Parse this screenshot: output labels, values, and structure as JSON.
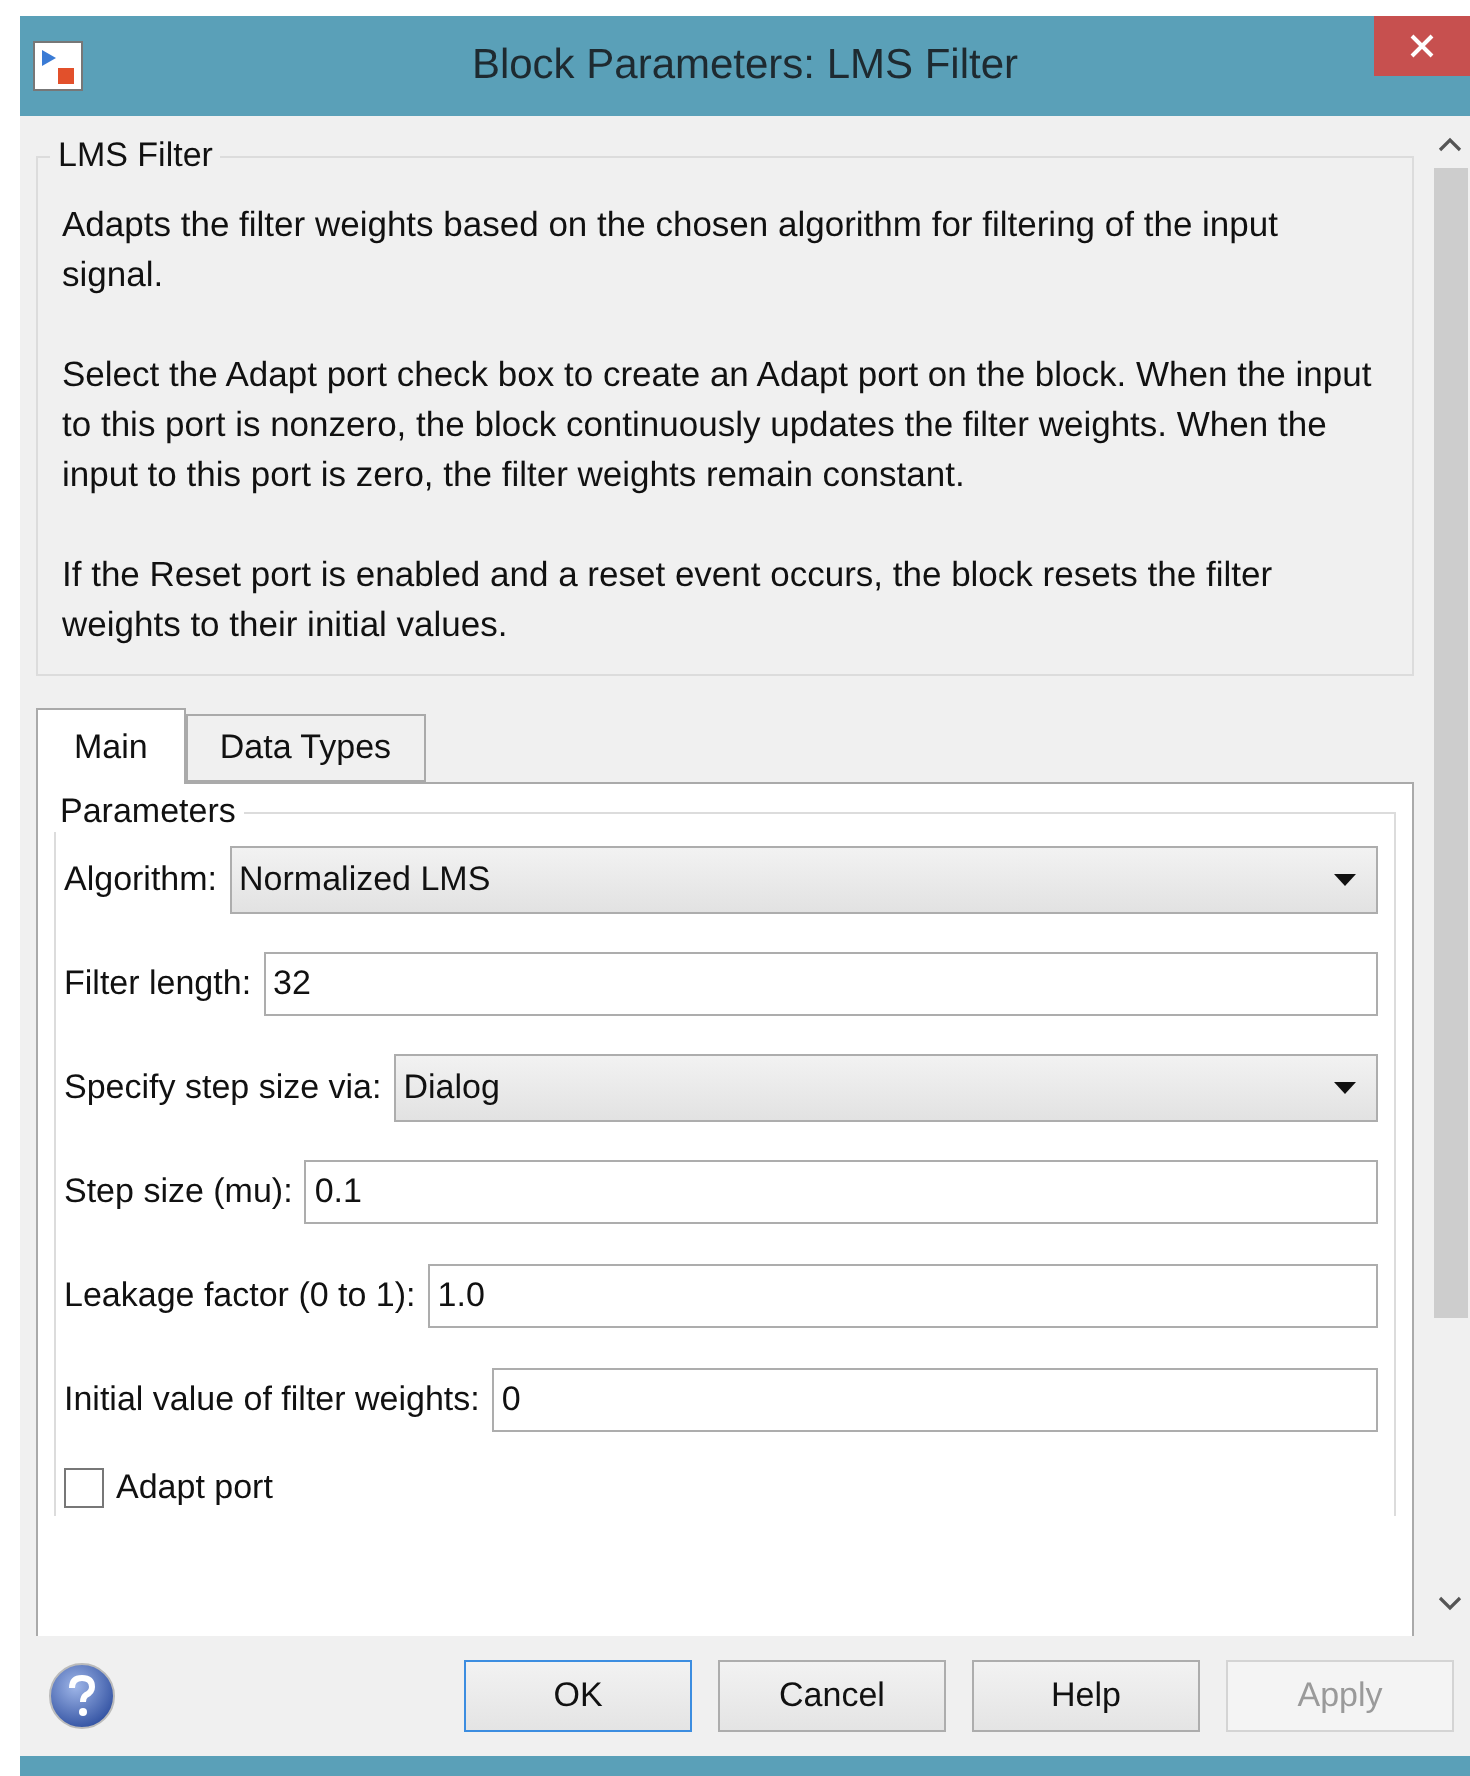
{
  "window": {
    "title": "Block Parameters: LMS Filter"
  },
  "description": {
    "title": "LMS Filter",
    "paragraphs": [
      "Adapts the filter weights based on the chosen algorithm for filtering of the input signal.",
      "Select the Adapt port check box to create an Adapt port on the block. When the input to this port is nonzero, the block continuously updates the filter weights. When the input to this port is zero, the filter weights remain constant.",
      "If the Reset port is enabled and a reset event occurs, the block resets the filter weights to their initial values."
    ]
  },
  "tabs": [
    {
      "label": "Main",
      "selected": true
    },
    {
      "label": "Data Types",
      "selected": false
    }
  ],
  "parameters": {
    "title": "Parameters",
    "fields": [
      {
        "kind": "dropdown",
        "label": "Algorithm:",
        "value": "Normalized LMS"
      },
      {
        "kind": "text",
        "label": "Filter length:",
        "value": "32"
      },
      {
        "kind": "dropdown",
        "label": "Specify step size via:",
        "value": "Dialog"
      },
      {
        "kind": "text",
        "label": "Step size (mu):",
        "value": "0.1"
      },
      {
        "kind": "text",
        "label": "Leakage factor (0 to 1):",
        "value": "1.0"
      },
      {
        "kind": "text",
        "label": "Initial value of filter weights:",
        "value": "0"
      },
      {
        "kind": "checkbox",
        "label": "Adapt port",
        "checked": false
      }
    ]
  },
  "buttons": [
    {
      "label": "OK",
      "default": true,
      "disabled": false
    },
    {
      "label": "Cancel",
      "default": false,
      "disabled": false
    },
    {
      "label": "Help",
      "default": false,
      "disabled": false
    },
    {
      "label": "Apply",
      "default": false,
      "disabled": true
    }
  ]
}
